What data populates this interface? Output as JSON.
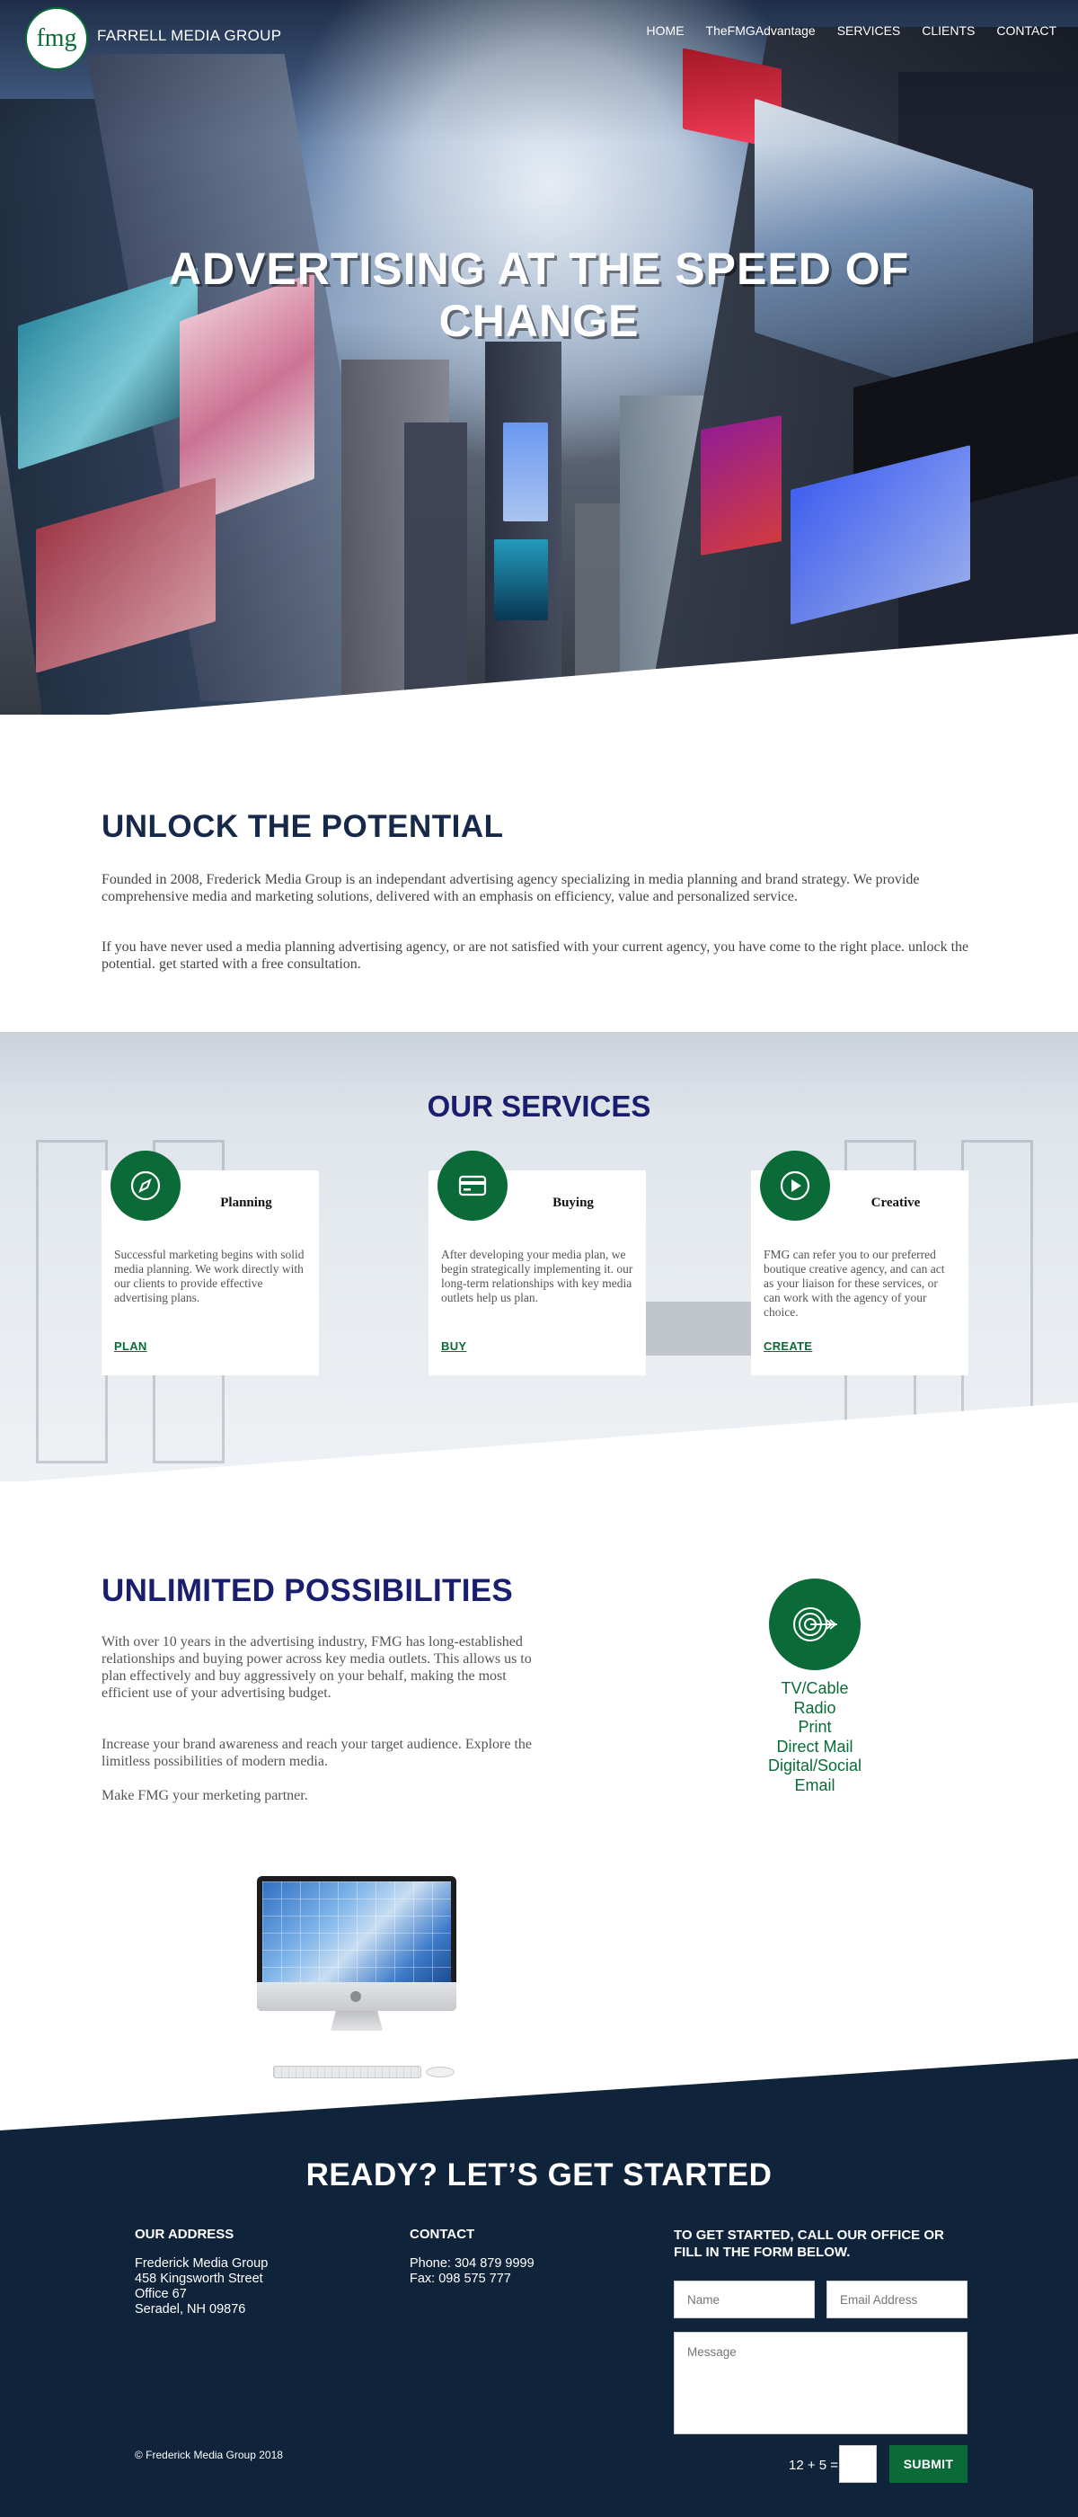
{
  "header": {
    "logo_text": "fmg",
    "brand_name": "FARRELL MEDIA GROUP",
    "nav": [
      "HOME",
      "TheFMGAdvantage",
      "SERVICES",
      "CLIENTS",
      "CONTACT"
    ]
  },
  "hero": {
    "title": "ADVERTISING AT THE SPEED OF CHANGE"
  },
  "unlock": {
    "title": "UNLOCK THE POTENTIAL",
    "paragraphs": [
      "Founded in 2008, Frederick Media Group is an independant advertising agency specializing in media planning and brand strategy. We provide comprehensive media and marketing solutions, delivered with an emphasis on efficiency, value and personalized service.",
      "If you have never used a media planning advertising agency, or are not satisfied with your current agency, you have come to the right place. unlock the potential. get started with a free consultation."
    ]
  },
  "services": {
    "title": "OUR SERVICES",
    "cards": [
      {
        "icon": "compass-icon",
        "title": "Planning",
        "text": "Successful marketing begins with solid media planning. We work directly with our clients to provide effective advertising plans.",
        "link": "PLAN"
      },
      {
        "icon": "credit-card-icon",
        "title": "Buying",
        "text": "After developing your media plan, we begin strategically implementing it. our long-term relationships with key media outlets help us plan.",
        "link": "BUY"
      },
      {
        "icon": "play-icon",
        "title": "Creative",
        "text": "FMG can refer you to our preferred boutique creative agency, and can act as your liaison for these services, or can work with the agency of your choice.",
        "link": "CREATE"
      }
    ]
  },
  "possibilities": {
    "title": "UNLIMITED POSSIBILITIES",
    "paragraphs": [
      "With over 10 years in the advertising industry, FMG has long-established relationships and buying power across key media outlets. This allows us to plan effectively and buy aggressively on your behalf, making the most efficient use of your advertising budget.",
      "Increase your brand awareness and reach your target audience. Explore the limitless possibilities of modern media.",
      "Make FMG your merketing partner."
    ],
    "icon": "target-arrow-icon",
    "media": [
      "TV/Cable",
      "Radio",
      "Print",
      "Direct Mail",
      "Digital/Social",
      "Email"
    ]
  },
  "footer": {
    "title": "READY? LET’S GET STARTED",
    "address_heading": "OUR ADDRESS",
    "address_lines": [
      "Frederick Media Group",
      "458 Kingsworth Street",
      "Office 67",
      "Seradel, NH 09876"
    ],
    "contact_heading": "CONTACT",
    "contact_lines": [
      "Phone: 304 879 9999",
      "Fax: 098 575 777"
    ],
    "form_heading": "TO GET STARTED, CALL OUR OFFICE OR FILL IN THE FORM BELOW.",
    "name_placeholder": "Name",
    "email_placeholder": "Email Address",
    "message_placeholder": "Message",
    "captcha_label": "12 + 5 =",
    "submit_label": "SUBMIT",
    "copyright": "© Frederick Media Group 2018"
  },
  "colors": {
    "brand_green": "#0b6b38",
    "navy": "#1a1e6e",
    "footer_bg": "#0f233a"
  }
}
